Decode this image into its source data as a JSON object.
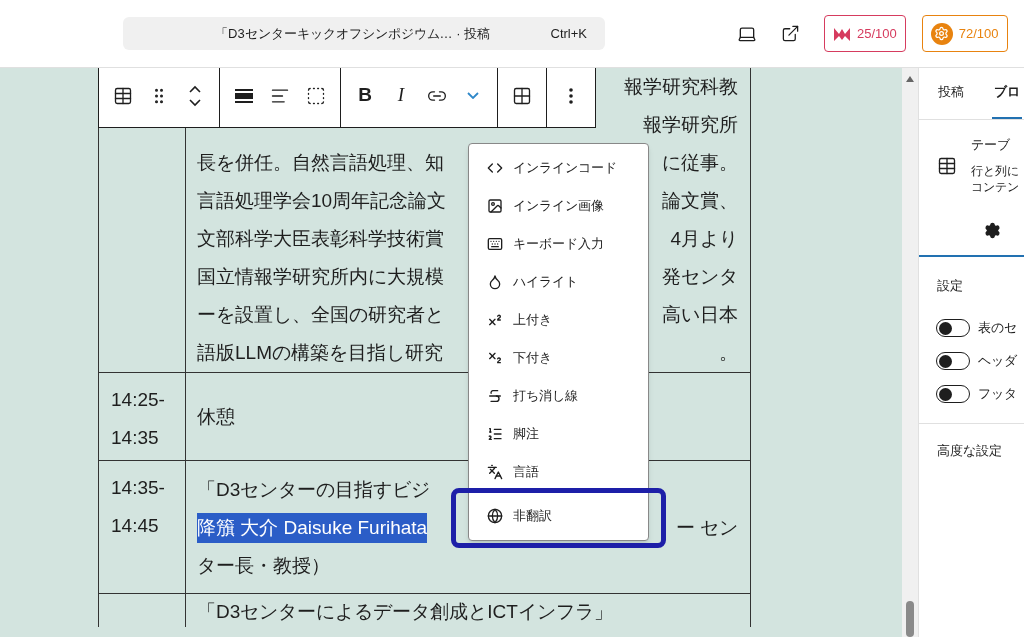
{
  "top_bar": {
    "command_bar": {
      "title": "「D3センターキックオフシンポジウム… · 投稿",
      "shortcut": "Ctrl+K"
    },
    "scores": [
      {
        "kind": "m",
        "value": "25/100",
        "color": "#d63b5e"
      },
      {
        "kind": "gear",
        "value": "72/100",
        "color": "#e8830f"
      }
    ]
  },
  "table": {
    "rows": [
      {
        "time": [],
        "lines": [
          {
            "right": "報学研究科教"
          },
          {
            "right": "報学研究所"
          },
          {
            "left": "長を併任。自然言語処理、知",
            "right": "に従事。"
          },
          {
            "left": "言語処理学会10周年記念論文",
            "right": "論文賞、"
          },
          {
            "left": "文部科学大臣表彰科学技術賞",
            "right": "4月より"
          },
          {
            "left": "国立情報学研究所内に大規模",
            "right": "発センタ"
          },
          {
            "left": "ーを設置し、全国の研究者と",
            "right": "高い日本"
          },
          {
            "left": "語版LLMの構築を目指し研究",
            "right": "。"
          }
        ]
      },
      {
        "time": [
          "14:25-",
          "14:35"
        ],
        "lines": [
          {
            "left": "休憩"
          }
        ]
      },
      {
        "time": [
          "14:35-",
          "14:45"
        ],
        "lines": [
          {
            "left": "「D3センターの目指すビジ"
          },
          {
            "left": "降籏 大介 Daisuke Furihata",
            "selected": true,
            "right": "ー セン"
          },
          {
            "left": "ター長・教授）"
          }
        ]
      },
      {
        "time": [],
        "lines": [
          {
            "left": "「D3センターによるデータ創成とICTインフラ」"
          }
        ]
      }
    ]
  },
  "block_toolbar": {
    "groups": [
      [
        {
          "kind": "table"
        },
        {
          "kind": "drag"
        },
        {
          "kind": "move"
        }
      ],
      [
        {
          "kind": "align"
        },
        {
          "kind": "text-align"
        },
        {
          "kind": "caption"
        }
      ],
      [
        {
          "kind": "bold",
          "label": "B"
        },
        {
          "kind": "italic",
          "label": "I"
        },
        {
          "kind": "link"
        },
        {
          "kind": "more",
          "expanded": true
        }
      ],
      [
        {
          "kind": "grid"
        }
      ],
      [
        {
          "kind": "dots"
        }
      ]
    ]
  },
  "format_menu": {
    "items": [
      {
        "label": "インラインコード",
        "highlighted": false
      },
      {
        "label": "インライン画像",
        "highlighted": false
      },
      {
        "label": "キーボード入力",
        "highlighted": false
      },
      {
        "label": "ハイライト",
        "highlighted": false
      },
      {
        "label": "上付き",
        "highlighted": false
      },
      {
        "label": "下付き",
        "highlighted": false
      },
      {
        "label": "打ち消し線",
        "highlighted": false
      },
      {
        "label": "脚注",
        "highlighted": false
      },
      {
        "label": "言語",
        "highlighted": false
      },
      {
        "label": "非翻訳",
        "highlighted": true
      }
    ]
  },
  "sidebar": {
    "tabs": [
      {
        "label": "投稿",
        "selected": false
      },
      {
        "label": "ブロ",
        "selected": true
      }
    ],
    "block": {
      "title": "テーブ",
      "description": [
        "行と列に",
        "コンテン"
      ]
    },
    "settings_title": "設定",
    "toggles": [
      {
        "label": "表のセ",
        "on": false
      },
      {
        "label": "ヘッダ",
        "on": false
      },
      {
        "label": "フッタ",
        "on": false
      }
    ],
    "advanced": "高度な設定"
  }
}
